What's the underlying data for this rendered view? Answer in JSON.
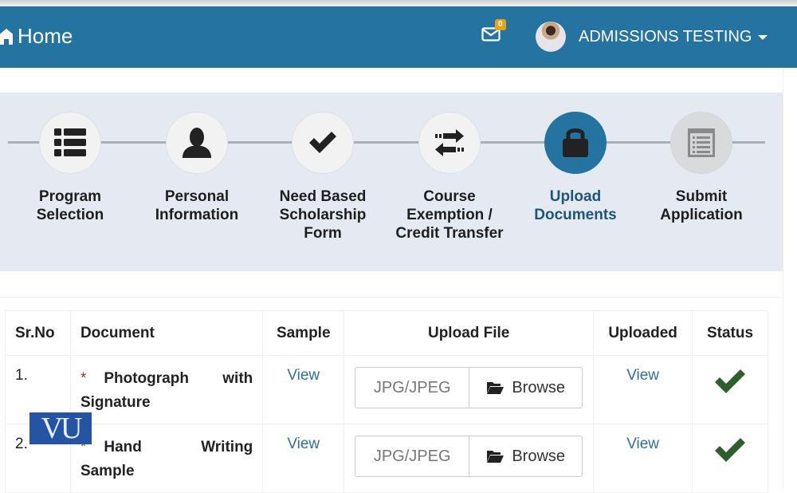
{
  "header": {
    "home_label": "Home",
    "mail_badge": "0",
    "user_name": "ADMISSIONS TESTING"
  },
  "wizard": {
    "steps": [
      {
        "label": "Program Selection",
        "icon": "list-icon",
        "state": "done"
      },
      {
        "label": "Personal Information",
        "icon": "user-icon",
        "state": "done"
      },
      {
        "label": "Need Based Scholarship Form",
        "icon": "check-icon",
        "state": "done"
      },
      {
        "label": "Course Exemption / Credit Transfer",
        "icon": "exchange-icon",
        "state": "done"
      },
      {
        "label": "Upload Documents",
        "icon": "lock-icon",
        "state": "active"
      },
      {
        "label": "Submit Application",
        "icon": "list-alt-icon",
        "state": "disabled"
      }
    ]
  },
  "table": {
    "headers": [
      "Sr.No",
      "Document",
      "Sample",
      "Upload File",
      "Uploaded",
      "Status"
    ],
    "rows": [
      {
        "sr": "1.",
        "required": "*",
        "document": "Photograph with Signature",
        "sample": "View",
        "file_type": "JPG/JPEG",
        "browse": "Browse",
        "uploaded": "View",
        "status": "complete"
      },
      {
        "sr": "2.",
        "required": "*",
        "document": "Hand Writing Sample",
        "sample": "View",
        "file_type": "JPG/JPEG",
        "browse": "Browse",
        "uploaded": "View",
        "status": "complete"
      }
    ]
  },
  "watermark": {
    "text": "VU"
  },
  "colors": {
    "navbar": "#2573a1",
    "wizard_bg": "#e5eaf2",
    "active_step_text": "#1f5577",
    "link": "#2f6f99",
    "status_check": "#2e5e2e",
    "badge": "#e8a317",
    "required": "#aa3333"
  }
}
